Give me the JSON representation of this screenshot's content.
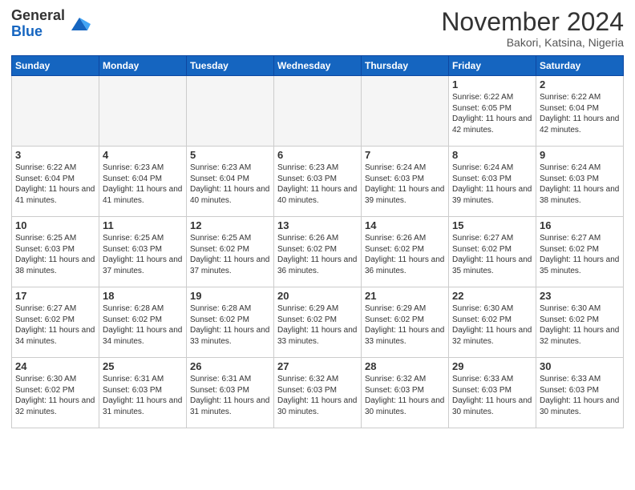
{
  "header": {
    "logo_general": "General",
    "logo_blue": "Blue",
    "month_title": "November 2024",
    "location": "Bakori, Katsina, Nigeria"
  },
  "weekdays": [
    "Sunday",
    "Monday",
    "Tuesday",
    "Wednesday",
    "Thursday",
    "Friday",
    "Saturday"
  ],
  "weeks": [
    [
      {
        "day": "",
        "info": ""
      },
      {
        "day": "",
        "info": ""
      },
      {
        "day": "",
        "info": ""
      },
      {
        "day": "",
        "info": ""
      },
      {
        "day": "",
        "info": ""
      },
      {
        "day": "1",
        "info": "Sunrise: 6:22 AM\nSunset: 6:05 PM\nDaylight: 11 hours\nand 42 minutes."
      },
      {
        "day": "2",
        "info": "Sunrise: 6:22 AM\nSunset: 6:04 PM\nDaylight: 11 hours\nand 42 minutes."
      }
    ],
    [
      {
        "day": "3",
        "info": "Sunrise: 6:22 AM\nSunset: 6:04 PM\nDaylight: 11 hours\nand 41 minutes."
      },
      {
        "day": "4",
        "info": "Sunrise: 6:23 AM\nSunset: 6:04 PM\nDaylight: 11 hours\nand 41 minutes."
      },
      {
        "day": "5",
        "info": "Sunrise: 6:23 AM\nSunset: 6:04 PM\nDaylight: 11 hours\nand 40 minutes."
      },
      {
        "day": "6",
        "info": "Sunrise: 6:23 AM\nSunset: 6:03 PM\nDaylight: 11 hours\nand 40 minutes."
      },
      {
        "day": "7",
        "info": "Sunrise: 6:24 AM\nSunset: 6:03 PM\nDaylight: 11 hours\nand 39 minutes."
      },
      {
        "day": "8",
        "info": "Sunrise: 6:24 AM\nSunset: 6:03 PM\nDaylight: 11 hours\nand 39 minutes."
      },
      {
        "day": "9",
        "info": "Sunrise: 6:24 AM\nSunset: 6:03 PM\nDaylight: 11 hours\nand 38 minutes."
      }
    ],
    [
      {
        "day": "10",
        "info": "Sunrise: 6:25 AM\nSunset: 6:03 PM\nDaylight: 11 hours\nand 38 minutes."
      },
      {
        "day": "11",
        "info": "Sunrise: 6:25 AM\nSunset: 6:03 PM\nDaylight: 11 hours\nand 37 minutes."
      },
      {
        "day": "12",
        "info": "Sunrise: 6:25 AM\nSunset: 6:02 PM\nDaylight: 11 hours\nand 37 minutes."
      },
      {
        "day": "13",
        "info": "Sunrise: 6:26 AM\nSunset: 6:02 PM\nDaylight: 11 hours\nand 36 minutes."
      },
      {
        "day": "14",
        "info": "Sunrise: 6:26 AM\nSunset: 6:02 PM\nDaylight: 11 hours\nand 36 minutes."
      },
      {
        "day": "15",
        "info": "Sunrise: 6:27 AM\nSunset: 6:02 PM\nDaylight: 11 hours\nand 35 minutes."
      },
      {
        "day": "16",
        "info": "Sunrise: 6:27 AM\nSunset: 6:02 PM\nDaylight: 11 hours\nand 35 minutes."
      }
    ],
    [
      {
        "day": "17",
        "info": "Sunrise: 6:27 AM\nSunset: 6:02 PM\nDaylight: 11 hours\nand 34 minutes."
      },
      {
        "day": "18",
        "info": "Sunrise: 6:28 AM\nSunset: 6:02 PM\nDaylight: 11 hours\nand 34 minutes."
      },
      {
        "day": "19",
        "info": "Sunrise: 6:28 AM\nSunset: 6:02 PM\nDaylight: 11 hours\nand 33 minutes."
      },
      {
        "day": "20",
        "info": "Sunrise: 6:29 AM\nSunset: 6:02 PM\nDaylight: 11 hours\nand 33 minutes."
      },
      {
        "day": "21",
        "info": "Sunrise: 6:29 AM\nSunset: 6:02 PM\nDaylight: 11 hours\nand 33 minutes."
      },
      {
        "day": "22",
        "info": "Sunrise: 6:30 AM\nSunset: 6:02 PM\nDaylight: 11 hours\nand 32 minutes."
      },
      {
        "day": "23",
        "info": "Sunrise: 6:30 AM\nSunset: 6:02 PM\nDaylight: 11 hours\nand 32 minutes."
      }
    ],
    [
      {
        "day": "24",
        "info": "Sunrise: 6:30 AM\nSunset: 6:02 PM\nDaylight: 11 hours\nand 32 minutes."
      },
      {
        "day": "25",
        "info": "Sunrise: 6:31 AM\nSunset: 6:03 PM\nDaylight: 11 hours\nand 31 minutes."
      },
      {
        "day": "26",
        "info": "Sunrise: 6:31 AM\nSunset: 6:03 PM\nDaylight: 11 hours\nand 31 minutes."
      },
      {
        "day": "27",
        "info": "Sunrise: 6:32 AM\nSunset: 6:03 PM\nDaylight: 11 hours\nand 30 minutes."
      },
      {
        "day": "28",
        "info": "Sunrise: 6:32 AM\nSunset: 6:03 PM\nDaylight: 11 hours\nand 30 minutes."
      },
      {
        "day": "29",
        "info": "Sunrise: 6:33 AM\nSunset: 6:03 PM\nDaylight: 11 hours\nand 30 minutes."
      },
      {
        "day": "30",
        "info": "Sunrise: 6:33 AM\nSunset: 6:03 PM\nDaylight: 11 hours\nand 30 minutes."
      }
    ]
  ]
}
